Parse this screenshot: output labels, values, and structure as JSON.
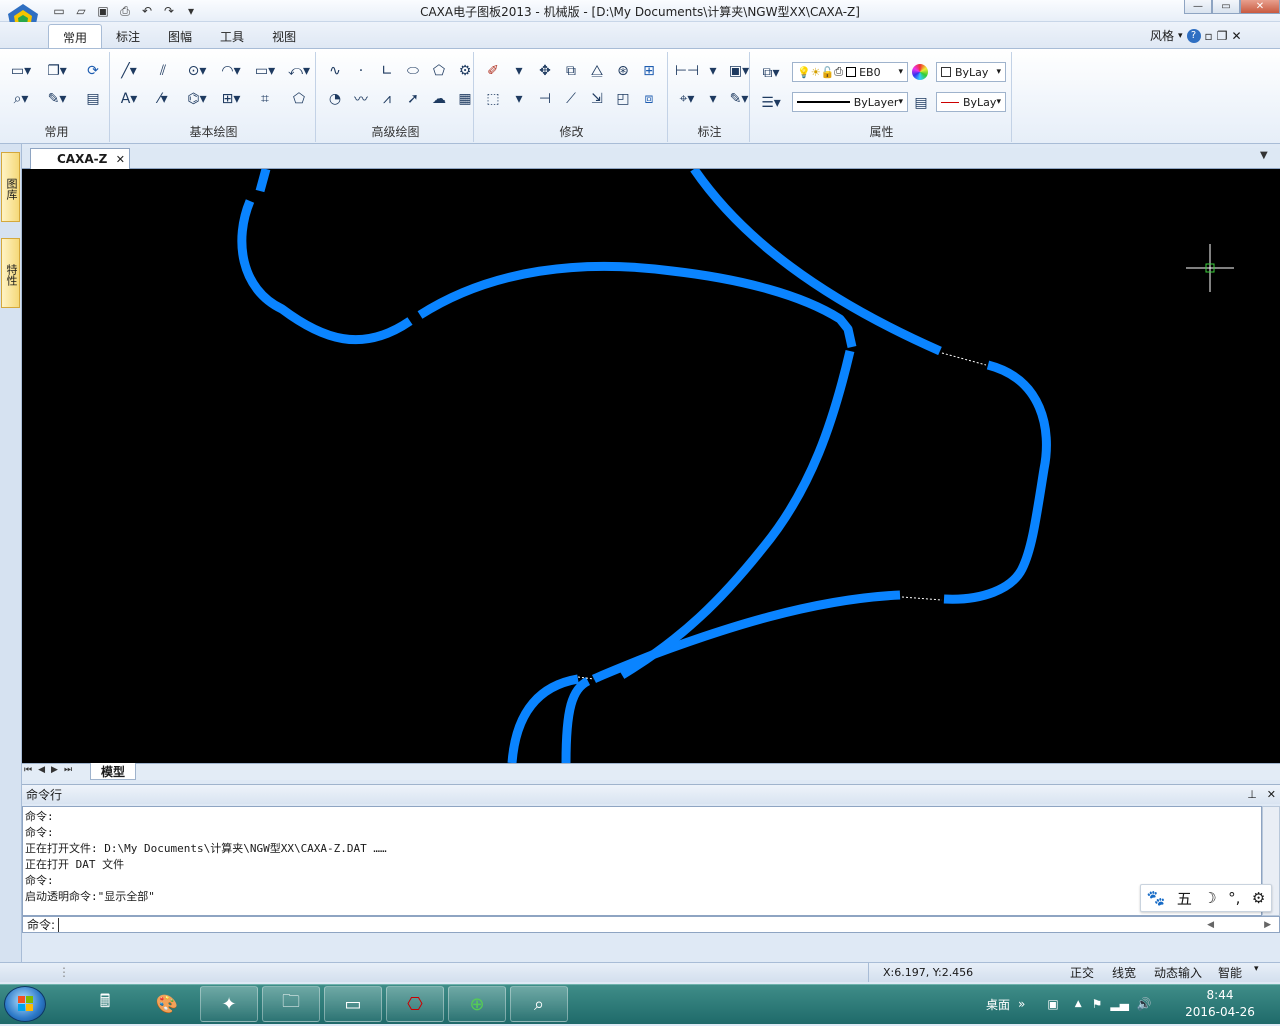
{
  "window": {
    "title": "CAXA电子图板2013 - 机械版 - [D:\\My Documents\\计算夹\\NGW型XX\\CAXA-Z]",
    "style_label": "风格"
  },
  "ribbon": {
    "tabs": [
      {
        "label": "常用",
        "active": true
      },
      {
        "label": "标注",
        "active": false
      },
      {
        "label": "图幅",
        "active": false
      },
      {
        "label": "工具",
        "active": false
      },
      {
        "label": "视图",
        "active": false
      }
    ],
    "groups": {
      "common": "常用",
      "basic_draw": "基本绘图",
      "advanced_draw": "高级绘图",
      "modify": "修改",
      "annotate": "标注",
      "properties": "属性"
    },
    "properties": {
      "layer_value": "EB0",
      "color_value": "ByLay",
      "linetype_value": "ByLayer",
      "lineweight_value": "ByLay"
    }
  },
  "side_panel": {
    "tab1": "图库",
    "tab2": "特性"
  },
  "document": {
    "tab_label": "CAXA-Z",
    "model_tab": "模型"
  },
  "command": {
    "header": "命令行",
    "lines": [
      "命令:",
      "命令:",
      "正在打开文件: D:\\My Documents\\计算夹\\NGW型XX\\CAXA-Z.DAT ……",
      "正在打开 DAT 文件",
      "命令:",
      "启动透明命令:\"显示全部\""
    ],
    "prompt": "命令:",
    "input_value": ""
  },
  "ime": {
    "mode": "五"
  },
  "status": {
    "coords": "X:6.197, Y:2.456",
    "toggles": [
      "正交",
      "线宽",
      "动态输入",
      "智能"
    ]
  },
  "taskbar": {
    "tray_label": "桌面",
    "time": "8:44",
    "date": "2016-04-26"
  },
  "colors": {
    "curve": "#0a84ff",
    "canvas": "#000000",
    "crosshair": "#ffffff"
  }
}
